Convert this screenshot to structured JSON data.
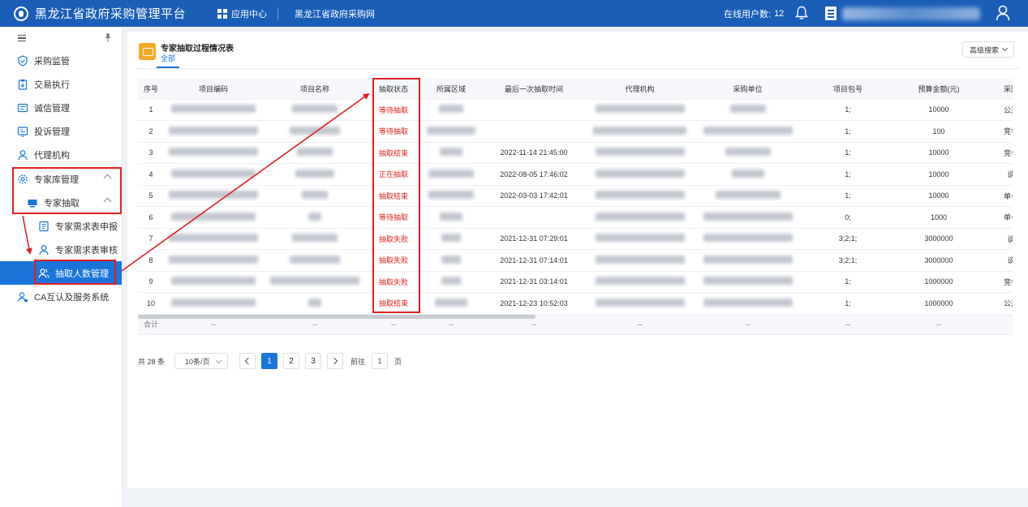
{
  "header": {
    "title": "黑龙江省政府采购管理平台",
    "apps_label": "应用中心",
    "site_label": "黑龙江省政府采购网",
    "online_label": "在线用户数:",
    "online_count": "12"
  },
  "sidebar": {
    "items": [
      {
        "label": "采购监管"
      },
      {
        "label": "交易执行"
      },
      {
        "label": "诚信管理"
      },
      {
        "label": "投诉管理"
      },
      {
        "label": "代理机构"
      },
      {
        "label": "专家库管理"
      },
      {
        "label": "专家抽取"
      },
      {
        "label": "专家需求表申报"
      },
      {
        "label": "专家需求表审核"
      },
      {
        "label": "抽取人数管理"
      },
      {
        "label": "CA互认及服务系统"
      }
    ]
  },
  "page": {
    "title": "专家抽取过程情况表",
    "tab": "全部",
    "advanced_search": "高级搜索"
  },
  "table": {
    "columns": [
      "序号",
      "项目编码",
      "项目名称",
      "抽取状态",
      "所属区域",
      "最后一次抽取时间",
      "代理机构",
      "采购单位",
      "项目包号",
      "预算金额(元)",
      "采购"
    ],
    "rows": [
      {
        "no": "1",
        "status": "等待抽取",
        "time": "",
        "pkg": "1;",
        "budget": "10000",
        "method": "公开"
      },
      {
        "no": "2",
        "status": "等待抽取",
        "time": "",
        "pkg": "1;",
        "budget": "100",
        "method": "竞争"
      },
      {
        "no": "3",
        "status": "抽取结束",
        "time": "2022-11-14 21:45:00",
        "pkg": "1;",
        "budget": "10000",
        "method": "竞争"
      },
      {
        "no": "4",
        "status": "正在抽取",
        "time": "2022-08-05 17:46:02",
        "pkg": "1;",
        "budget": "10000",
        "method": "谈"
      },
      {
        "no": "5",
        "status": "抽取结束",
        "time": "2022-03-03 17:42:01",
        "pkg": "1;",
        "budget": "10000",
        "method": "单一"
      },
      {
        "no": "6",
        "status": "等待抽取",
        "time": "",
        "pkg": "0;",
        "budget": "1000",
        "method": "单一"
      },
      {
        "no": "7",
        "status": "抽取失败",
        "time": "2021-12-31 07:29:01",
        "pkg": "3;2;1;",
        "budget": "3000000",
        "method": "谈"
      },
      {
        "no": "8",
        "status": "抽取失败",
        "time": "2021-12-31 07:14:01",
        "pkg": "3;2;1;",
        "budget": "3000000",
        "method": "谈"
      },
      {
        "no": "9",
        "status": "抽取失败",
        "time": "2021-12-31 03:14:01",
        "pkg": "1;",
        "budget": "1000000",
        "method": "竞争"
      },
      {
        "no": "10",
        "status": "抽取结束",
        "time": "2021-12-23 10:52:03",
        "pkg": "1;",
        "budget": "1000000",
        "method": "公开"
      }
    ],
    "total_label": "合计",
    "total_placeholder": "--"
  },
  "pagination": {
    "total": "共 28 条",
    "page_size": "10条/页",
    "pages": [
      "1",
      "2",
      "3"
    ],
    "current": "1",
    "goto_label": "前往",
    "goto_value": "1",
    "page_suffix": "页"
  },
  "colors": {
    "primary": "#1a5eb8",
    "active": "#1a74d9",
    "status_red": "#e02020",
    "highlight_red": "#e02020"
  }
}
